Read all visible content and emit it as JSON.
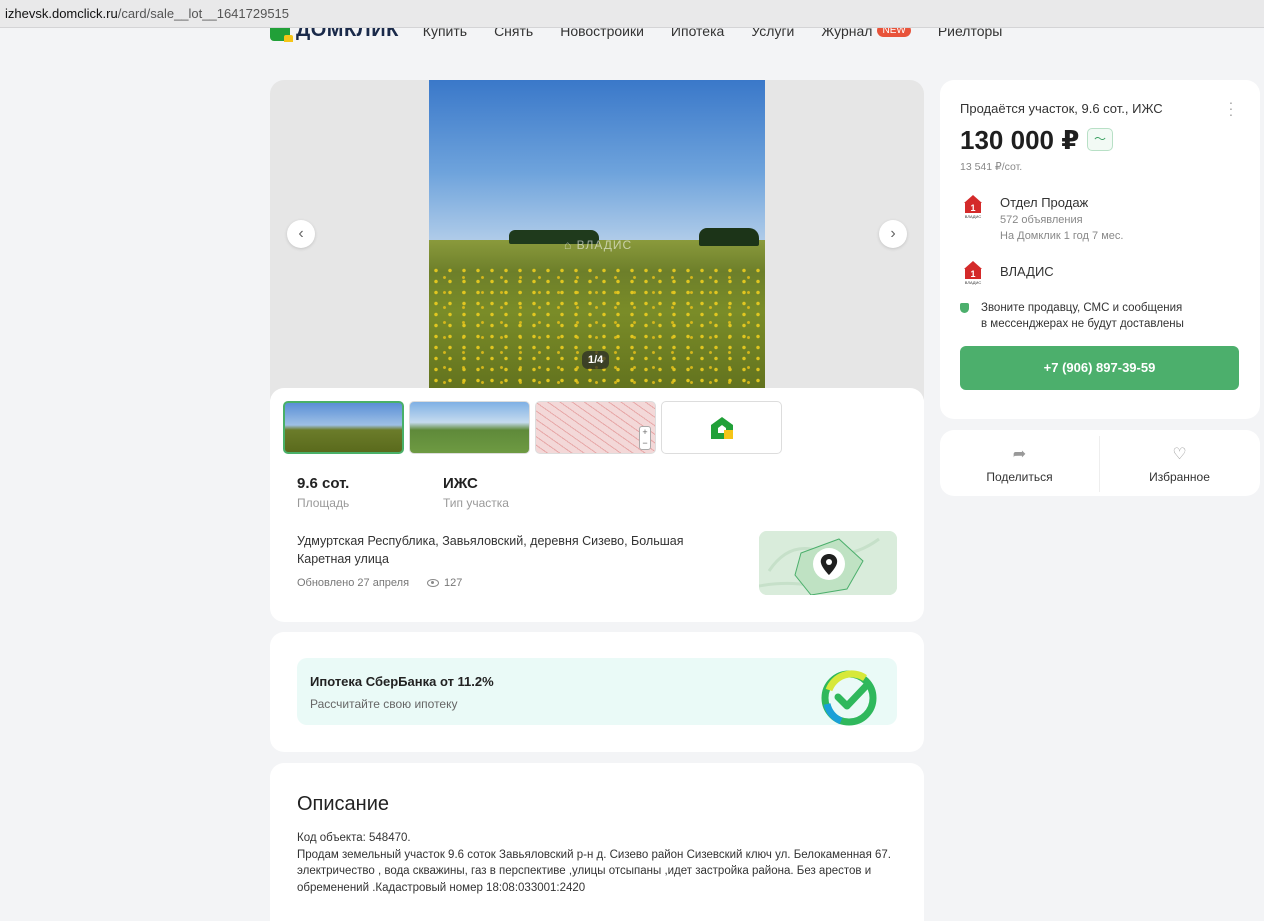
{
  "browser": {
    "url_host": "izhevsk.domclick.ru",
    "url_path": "/card/sale__lot__1641729515"
  },
  "nav": {
    "logo_text": "ДОМКЛИК",
    "items": [
      {
        "label": "Купить"
      },
      {
        "label": "Снять"
      },
      {
        "label": "Новостройки"
      },
      {
        "label": "Ипотека"
      },
      {
        "label": "Услуги"
      },
      {
        "label": "Журнал",
        "badge": "NEW"
      },
      {
        "label": "Риелторы"
      }
    ]
  },
  "gallery": {
    "counter": "1/4",
    "watermark": "ВЛАДИС",
    "prev_icon": "chevron-left-icon",
    "next_icon": "chevron-right-icon"
  },
  "specs": [
    {
      "value": "9.6 сот.",
      "label": "Площадь"
    },
    {
      "value": "ИЖС",
      "label": "Тип участка"
    }
  ],
  "address": "Удмуртская Республика, Завьяловский, деревня Сизево, Большая Каретная улица",
  "updated": "Обновлено 27 апреля",
  "views": "127",
  "mortgage": {
    "title": "Ипотека СберБанка от 11.2%",
    "subtitle": "Рассчитайте свою ипотеку"
  },
  "description": {
    "title": "Описание",
    "code": "Код объекта: 548470.",
    "body": "Продам земельный участок 9.6 соток Завьяловский р-н д. Сизево район Сизевский ключ ул. Белокаменная 67. электричество , вода скважины, газ в перспективе ,улицы отсыпаны ,идет застройка района. Без арестов и обременений .Кадастровый номер 18:08:033001:2420"
  },
  "price_card": {
    "title": "Продаётся участок, 9.6 сот., ИЖС",
    "price": "130 000 ₽",
    "per_sotka": "13 541 ₽/сот.",
    "seller_department": "Отдел Продаж",
    "seller_listings": "572 объявления",
    "seller_tenure": "На Домклик 1 год 7 мес.",
    "agency_name": "ВЛАДИС",
    "agency_logo_text": "ВЛАДИС",
    "notice_line1": "Звоните продавцу, СМС и сообщения",
    "notice_line2": "в мессенджерах не будут доставлены",
    "phone": "+7 (906) 897-39-59"
  },
  "actions": {
    "share": "Поделиться",
    "favorite": "Избранное"
  },
  "colors": {
    "accent": "#4caf6c",
    "brand_red": "#d42a2a",
    "page_bg": "#f3f4f6"
  }
}
